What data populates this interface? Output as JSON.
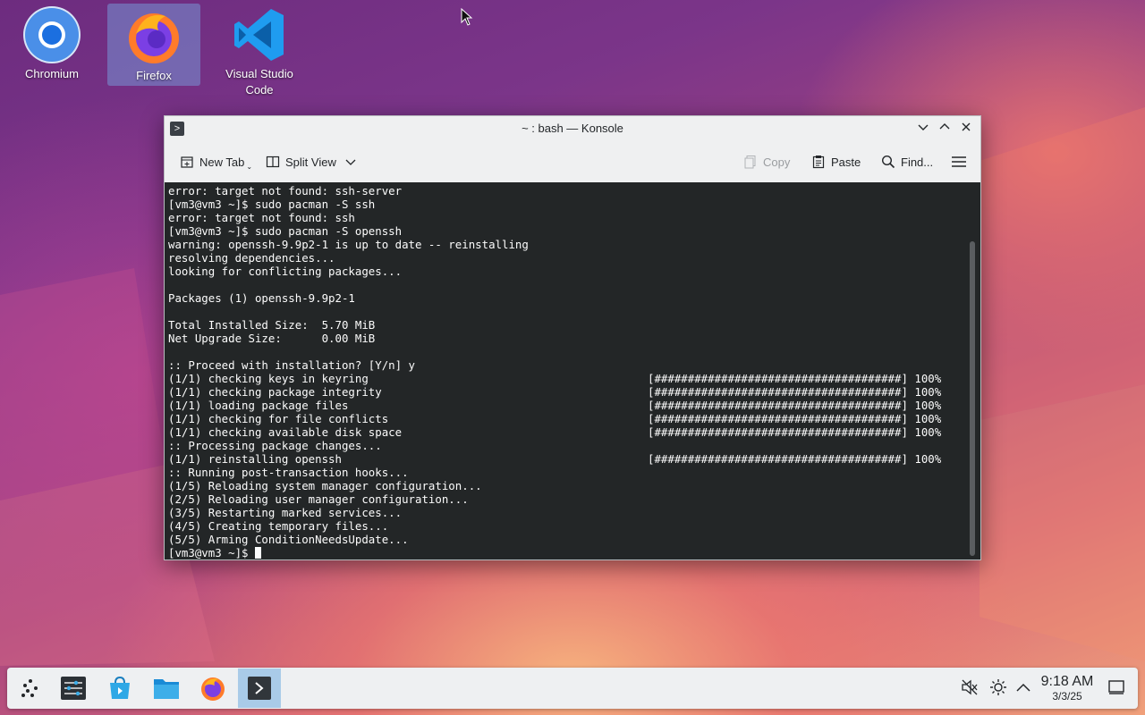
{
  "desktop": {
    "icons": [
      {
        "label": "Chromium"
      },
      {
        "label": "Firefox"
      },
      {
        "label": "Visual Studio Code"
      }
    ]
  },
  "window": {
    "title": "~ : bash — Konsole",
    "toolbar": {
      "new_tab": "New Tab",
      "split_view": "Split View",
      "copy": "Copy",
      "paste": "Paste",
      "find": "Find..."
    }
  },
  "terminal": {
    "lines": [
      {
        "text": "error: target not found: ssh-server",
        "progress": ""
      },
      {
        "text": "[vm3@vm3 ~]$ sudo pacman -S ssh",
        "progress": ""
      },
      {
        "text": "error: target not found: ssh",
        "progress": ""
      },
      {
        "text": "[vm3@vm3 ~]$ sudo pacman -S openssh",
        "progress": ""
      },
      {
        "text": "warning: openssh-9.9p2-1 is up to date -- reinstalling",
        "progress": ""
      },
      {
        "text": "resolving dependencies...",
        "progress": ""
      },
      {
        "text": "looking for conflicting packages...",
        "progress": ""
      },
      {
        "text": "",
        "progress": ""
      },
      {
        "text": "Packages (1) openssh-9.9p2-1",
        "progress": ""
      },
      {
        "text": "",
        "progress": ""
      },
      {
        "text": "Total Installed Size:  5.70 MiB",
        "progress": ""
      },
      {
        "text": "Net Upgrade Size:      0.00 MiB",
        "progress": ""
      },
      {
        "text": "",
        "progress": ""
      },
      {
        "text": ":: Proceed with installation? [Y/n] y",
        "progress": ""
      },
      {
        "text": "(1/1) checking keys in keyring",
        "progress": "[#####################################] 100%"
      },
      {
        "text": "(1/1) checking package integrity",
        "progress": "[#####################################] 100%"
      },
      {
        "text": "(1/1) loading package files",
        "progress": "[#####################################] 100%"
      },
      {
        "text": "(1/1) checking for file conflicts",
        "progress": "[#####################################] 100%"
      },
      {
        "text": "(1/1) checking available disk space",
        "progress": "[#####################################] 100%"
      },
      {
        "text": ":: Processing package changes...",
        "progress": ""
      },
      {
        "text": "(1/1) reinstalling openssh",
        "progress": "[#####################################] 100%"
      },
      {
        "text": ":: Running post-transaction hooks...",
        "progress": ""
      },
      {
        "text": "(1/5) Reloading system manager configuration...",
        "progress": ""
      },
      {
        "text": "(2/5) Reloading user manager configuration...",
        "progress": ""
      },
      {
        "text": "(3/5) Restarting marked services...",
        "progress": ""
      },
      {
        "text": "(4/5) Creating temporary files...",
        "progress": ""
      },
      {
        "text": "(5/5) Arming ConditionNeedsUpdate...",
        "progress": ""
      }
    ],
    "prompt": "[vm3@vm3 ~]$ "
  },
  "taskbar": {
    "clock_time": "9:18 AM",
    "clock_date": "3/3/25"
  },
  "icons": {
    "app_launcher": "app-launcher-icon",
    "system_settings": "system-settings-icon",
    "discover": "discover-store-icon",
    "dolphin": "folder-icon",
    "firefox": "firefox-icon",
    "konsole": "konsole-icon",
    "volume": "volume-muted-icon",
    "brightness": "brightness-icon",
    "tray_expand": "chevron-up-icon",
    "show_desktop": "show-desktop-icon"
  },
  "colors": {
    "terminal_bg": "#232627",
    "terminal_fg": "#fcfcfc",
    "active_task": "#a9cbe8"
  }
}
